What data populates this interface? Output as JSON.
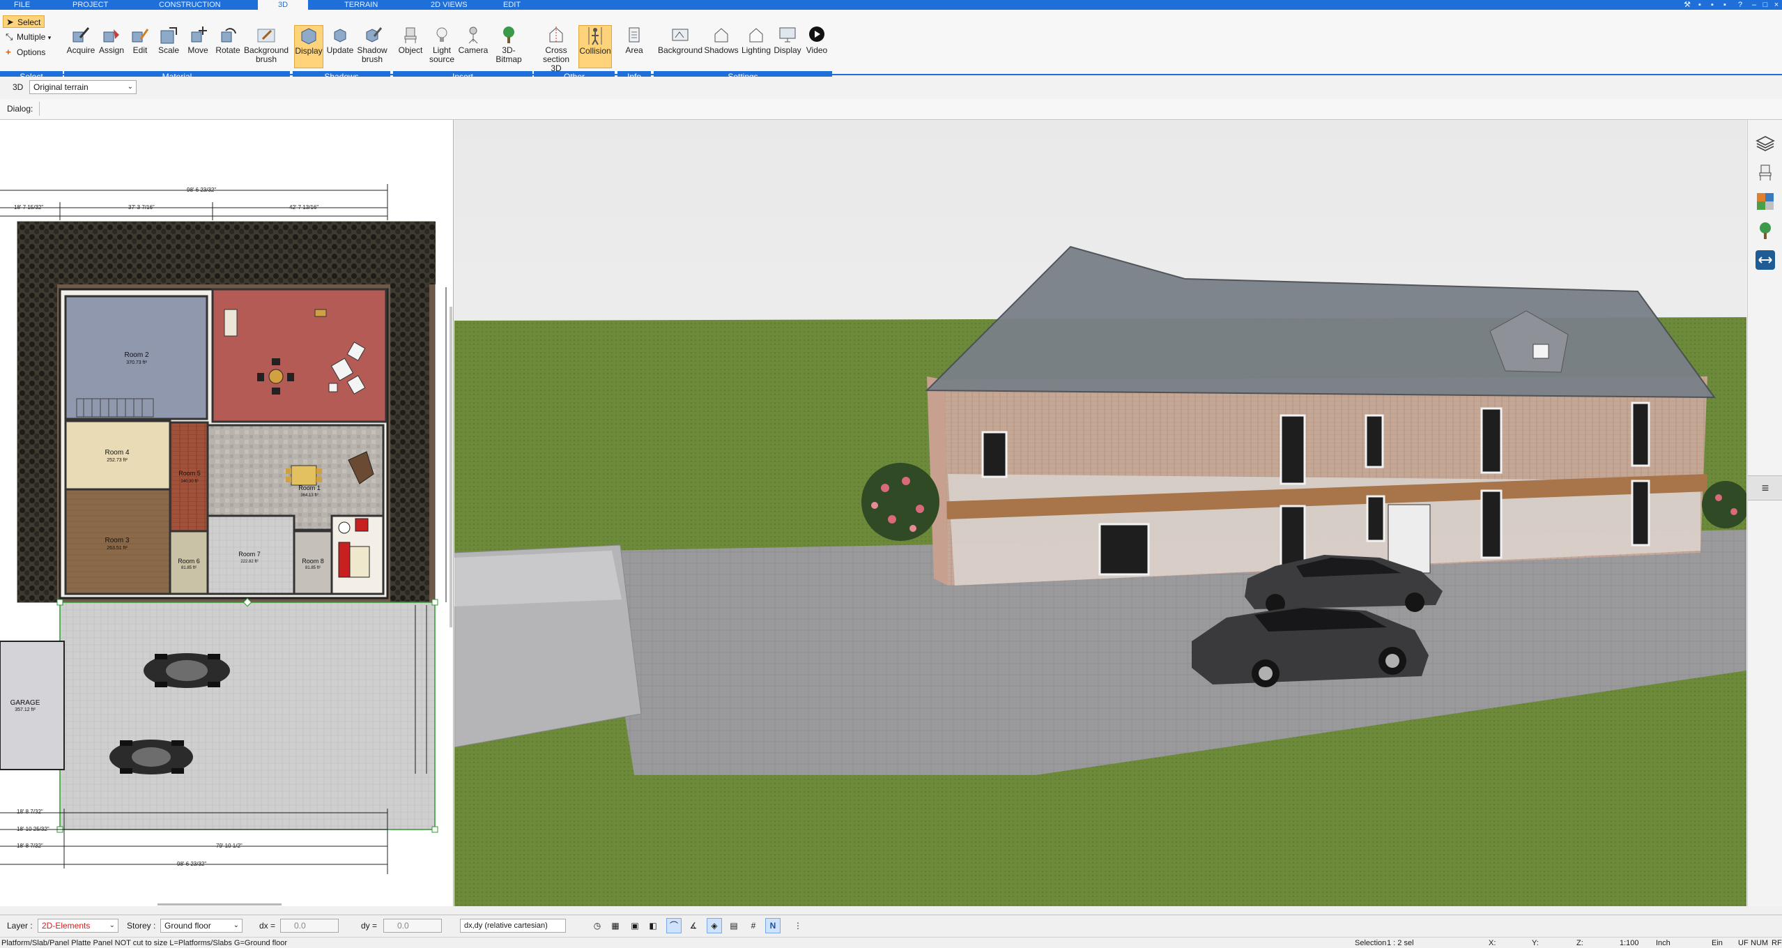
{
  "menu": {
    "tabs": [
      {
        "label": "FILE",
        "active": false
      },
      {
        "label": "PROJECT",
        "active": false
      },
      {
        "label": "CONSTRUCTION",
        "active": false
      },
      {
        "label": "3D",
        "active": true
      },
      {
        "label": "TERRAIN",
        "active": false
      },
      {
        "label": "2D VIEWS",
        "active": false
      },
      {
        "label": "EDIT",
        "active": false
      }
    ]
  },
  "ribbon": {
    "select_group": {
      "items": [
        "Select",
        "Multiple",
        "Options"
      ],
      "label": "Select"
    },
    "material_group": {
      "buttons": [
        "Acquire",
        "Assign",
        "Edit",
        "Scale",
        "Move",
        "Rotate",
        "Background\nbrush"
      ],
      "label": "Material"
    },
    "shadows_group": {
      "buttons": [
        "Display",
        "Update",
        "Shadow\nbrush"
      ],
      "label": "Shadows"
    },
    "insert_group": {
      "buttons": [
        "Object",
        "Light\nsource",
        "Camera",
        "3D-Bitmap"
      ],
      "label": "Insert"
    },
    "other_group": {
      "buttons": [
        "Cross\nsection 3D",
        "Collision"
      ],
      "label": "Other"
    },
    "info_group": {
      "buttons": [
        "Area"
      ],
      "label": "Info"
    },
    "settings_group": {
      "buttons": [
        "Background",
        "Shadows",
        "Lighting",
        "Display",
        "Video"
      ],
      "label": "Settings"
    }
  },
  "subbar": {
    "mode": "3D",
    "terrain_select": "Original terrain",
    "dialog_label": "Dialog:"
  },
  "plan": {
    "dims_top": [
      "98' 6 23/32\"",
      "18' 7 15/32\"",
      "37' 3 7/16\"",
      "42' 7 13/16\""
    ],
    "dims_bottom": [
      "18' 8 7/32\"",
      "18' 10 25/32\"",
      "18' 8 7/32\"",
      "79' 10 1/2\"",
      "98' 6 23/32\""
    ],
    "rooms": [
      {
        "name": "Room 2",
        "area": "370.73 ft²"
      },
      {
        "name": "Room 4",
        "area": "252.73 ft²"
      },
      {
        "name": "Room 3",
        "area": "263.51 ft²"
      },
      {
        "name": "Room 5",
        "area": "140.30 ft²"
      },
      {
        "name": "Room 1",
        "area": "364.13 ft²"
      },
      {
        "name": "Room 6",
        "area": "81.85 ft²"
      },
      {
        "name": "Room 7",
        "area": "222.82 ft²"
      },
      {
        "name": "Room 8",
        "area": "81.85 ft²"
      },
      {
        "name": "GARAGE",
        "area": "357.12 ft²"
      }
    ]
  },
  "status": {
    "layer_label": "Layer :",
    "layer_value": "2D-Elements",
    "storey_label": "Storey :",
    "storey_value": "Ground floor",
    "dx_label": "dx =",
    "dx_value": "0.0",
    "dy_label": "dy =",
    "dy_value": "0.0",
    "coord_mode": "dx,dy (relative cartesian)"
  },
  "info": {
    "hint": "Platform/Slab/Panel Platte Panel NOT cut to size L=Platforms/Slabs G=Ground floor",
    "selection_label": "Selection",
    "selection_value": "1 : 2 sel",
    "x_label": "X:",
    "y_label": "Y:",
    "z_label": "Z:",
    "scale": "1:100",
    "unit": "Inch",
    "mode": "Ein",
    "uf": "UF",
    "num": "NUM",
    "rf": "RF"
  },
  "colors": {
    "accent": "#1e6fd9",
    "active_button": "#ffd37a",
    "layer_text": "#d22020"
  }
}
